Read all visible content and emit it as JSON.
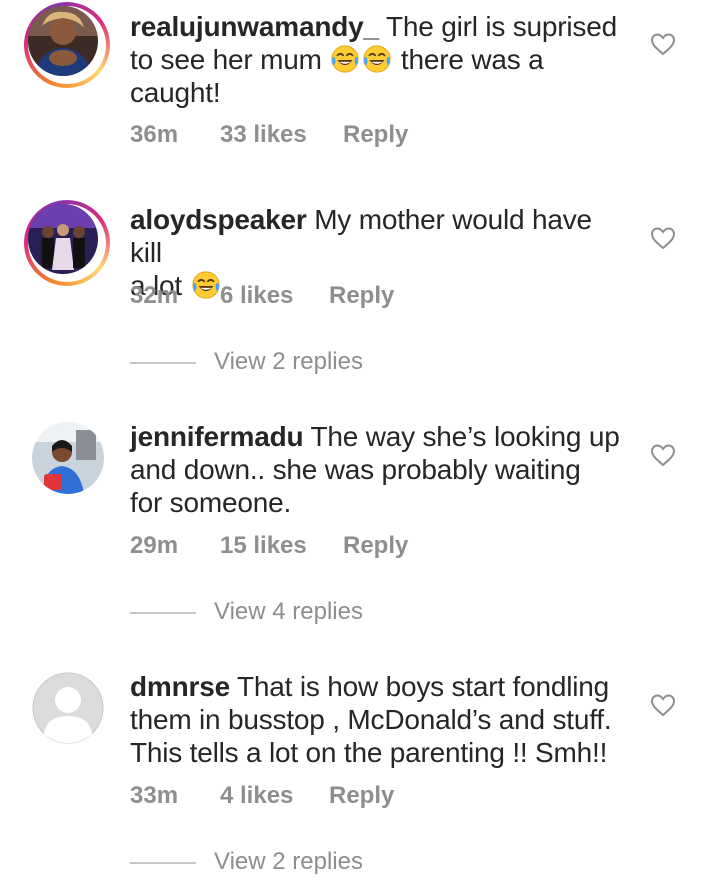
{
  "comments": [
    {
      "username": "realujunwamandy_",
      "text_1": "The girl is suprised",
      "text_2": "to see her mum",
      "emoji_1": "laughing-tears",
      "emoji_2": "laughing-tears",
      "text_3": "there was a",
      "text_4": "caught!",
      "time": "36m",
      "likes": "33 likes",
      "reply": "Reply"
    },
    {
      "username": "aloydspeaker",
      "text_1": "My mother would have kill",
      "text_2": "a lot",
      "emoji_1": "laughing-tears",
      "time": "32m",
      "likes": "6 likes",
      "reply": "Reply",
      "view_replies": "View 2 replies"
    },
    {
      "username": "jennifermadu",
      "text_1": "The way she’s looking up",
      "text_2": "and down.. she was probably waiting",
      "text_3": "for someone.",
      "time": "29m",
      "likes": "15 likes",
      "reply": "Reply",
      "view_replies": "View 4 replies"
    },
    {
      "username": "dmnrse",
      "text_1": "That is how boys start fondling",
      "text_2": "them in busstop , McDonald’s and stuff.",
      "text_3": "This tells a lot on the parenting !! Smh!!",
      "time": "33m",
      "likes": "4 likes",
      "reply": "Reply",
      "view_replies": "View 2 replies"
    }
  ],
  "colors": {
    "text": "#262626",
    "secondary": "#8e8e8e",
    "divider": "#c7c7c7",
    "heart_outline": "#8e8e8e"
  },
  "icons": {
    "like": "heart-outline-icon",
    "default_avatar": "default-avatar-icon"
  }
}
